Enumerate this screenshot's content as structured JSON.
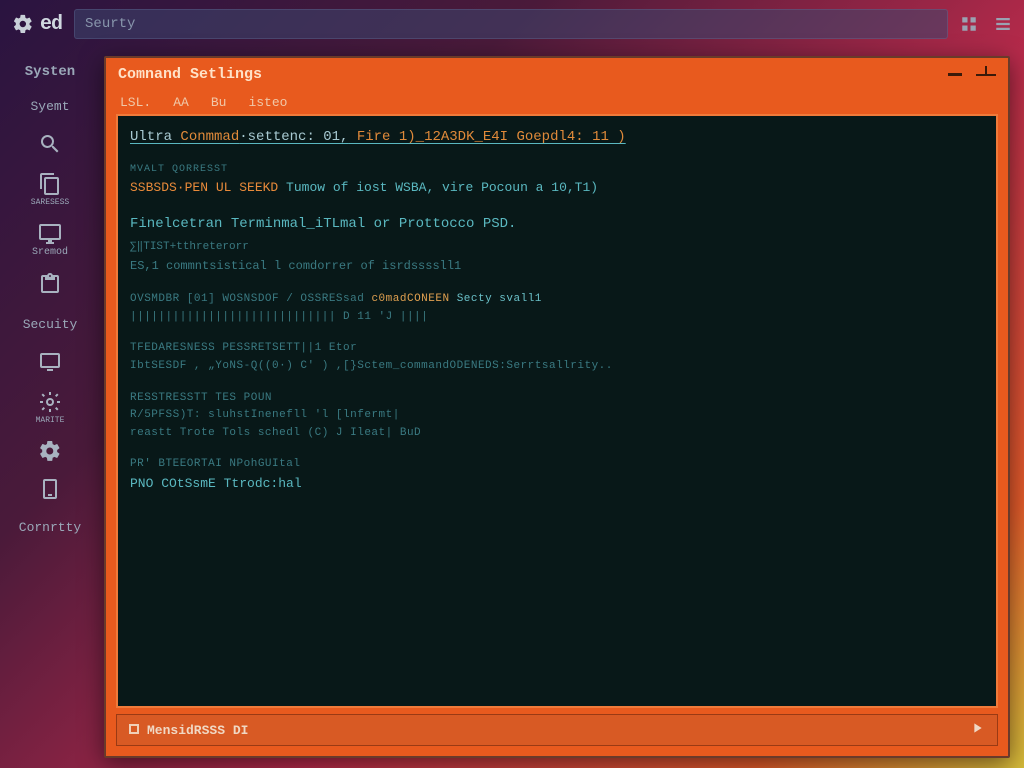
{
  "topbar": {
    "brand": "ed",
    "address": "Seurty"
  },
  "sidebar": {
    "items": [
      {
        "label": "Systen"
      },
      {
        "label": "Syemt"
      },
      {
        "label": ""
      },
      {
        "label": "SARESESS"
      },
      {
        "label": "Sremod"
      },
      {
        "label": ""
      },
      {
        "label": "Secuity"
      },
      {
        "label": ""
      },
      {
        "label": "MARITE"
      },
      {
        "label": ""
      },
      {
        "label": ""
      },
      {
        "label": "Cornrtty"
      }
    ]
  },
  "terminal": {
    "title": "Comnand Setlings",
    "menu": [
      "LSL.",
      "AA",
      "Bu",
      "isteo"
    ],
    "status_left": "MensidRSSS DI",
    "lines": {
      "header_a": "Ultra ",
      "header_b": "Conmmad",
      "header_c": "·settenc: 01,",
      "header_d": " Fire 1)_12A3DK_E4I Goepdl4: 11 )",
      "l2a": "MVALT  QORRESST",
      "l2b": "SSBSDS·PEN UL SEEKD",
      "l2c": " Tumow of iost WSBA, vire Pocoun a 10,T1)",
      "l3a": "Finelcetran Terminmal_iTLmal or Prottocco PSD.",
      "l3b": "∑‖TIST+tthreterorr",
      "l3c": "ES,1 commntsistical l comdorrer of isrdssssll1",
      "l4a": "OVSMDBR   [01] WOSNSDOF /  OSSRESsad",
      "l4b": "c0mad",
      "l4c": "CONEEN",
      "l4d": "Secty svall1",
      "l5": "|||||||||||||||||||||||||||||  D 11  'J ||||",
      "l6a": "TFEDARESNESS   PESSRETSETT||1    Etor",
      "l6b": "IbtSESDF , „YoNS-Q((0·) C' ) ,[}Sctem_commandODENEDS:Serrtsallrity..",
      "l7a": "RESSTRESSTT     TES   POUN",
      "l7b": "R/5PFSS)T: sluhstInenefll 'l   [lnfermt|",
      "l7c": "reastt  Trote   Tols  schedl (C) J Ileat|   BuD",
      "l8a": "PR'  BTEEORTAI   NPohGUItal",
      "l8b": "PNO COtSsmE Ttrodc:hal"
    }
  }
}
